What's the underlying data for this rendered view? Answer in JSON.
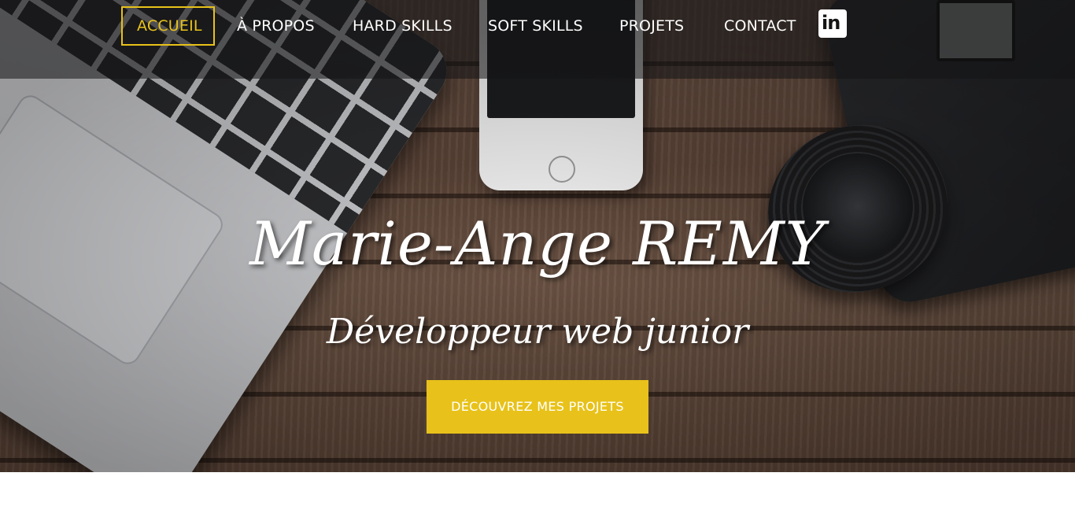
{
  "nav": {
    "items": [
      {
        "label": "ACCUEIL",
        "active": true
      },
      {
        "label": "À PROPOS",
        "active": false
      },
      {
        "label": "HARD SKILLS",
        "active": false
      },
      {
        "label": "SOFT SKILLS",
        "active": false
      },
      {
        "label": "PROJETS",
        "active": false
      },
      {
        "label": "CONTACT",
        "active": false
      }
    ],
    "social_icon": "linkedin-icon",
    "social_icon_text": "in"
  },
  "hero": {
    "title": "Marie-Ange REMY",
    "subtitle": "Développeur web junior",
    "cta_label": "DÉCOUVREZ MES PROJETS"
  },
  "colors": {
    "accent": "#e8c21a",
    "nav_overlay": "rgba(20,20,22,0.55)",
    "text": "#ffffff"
  }
}
